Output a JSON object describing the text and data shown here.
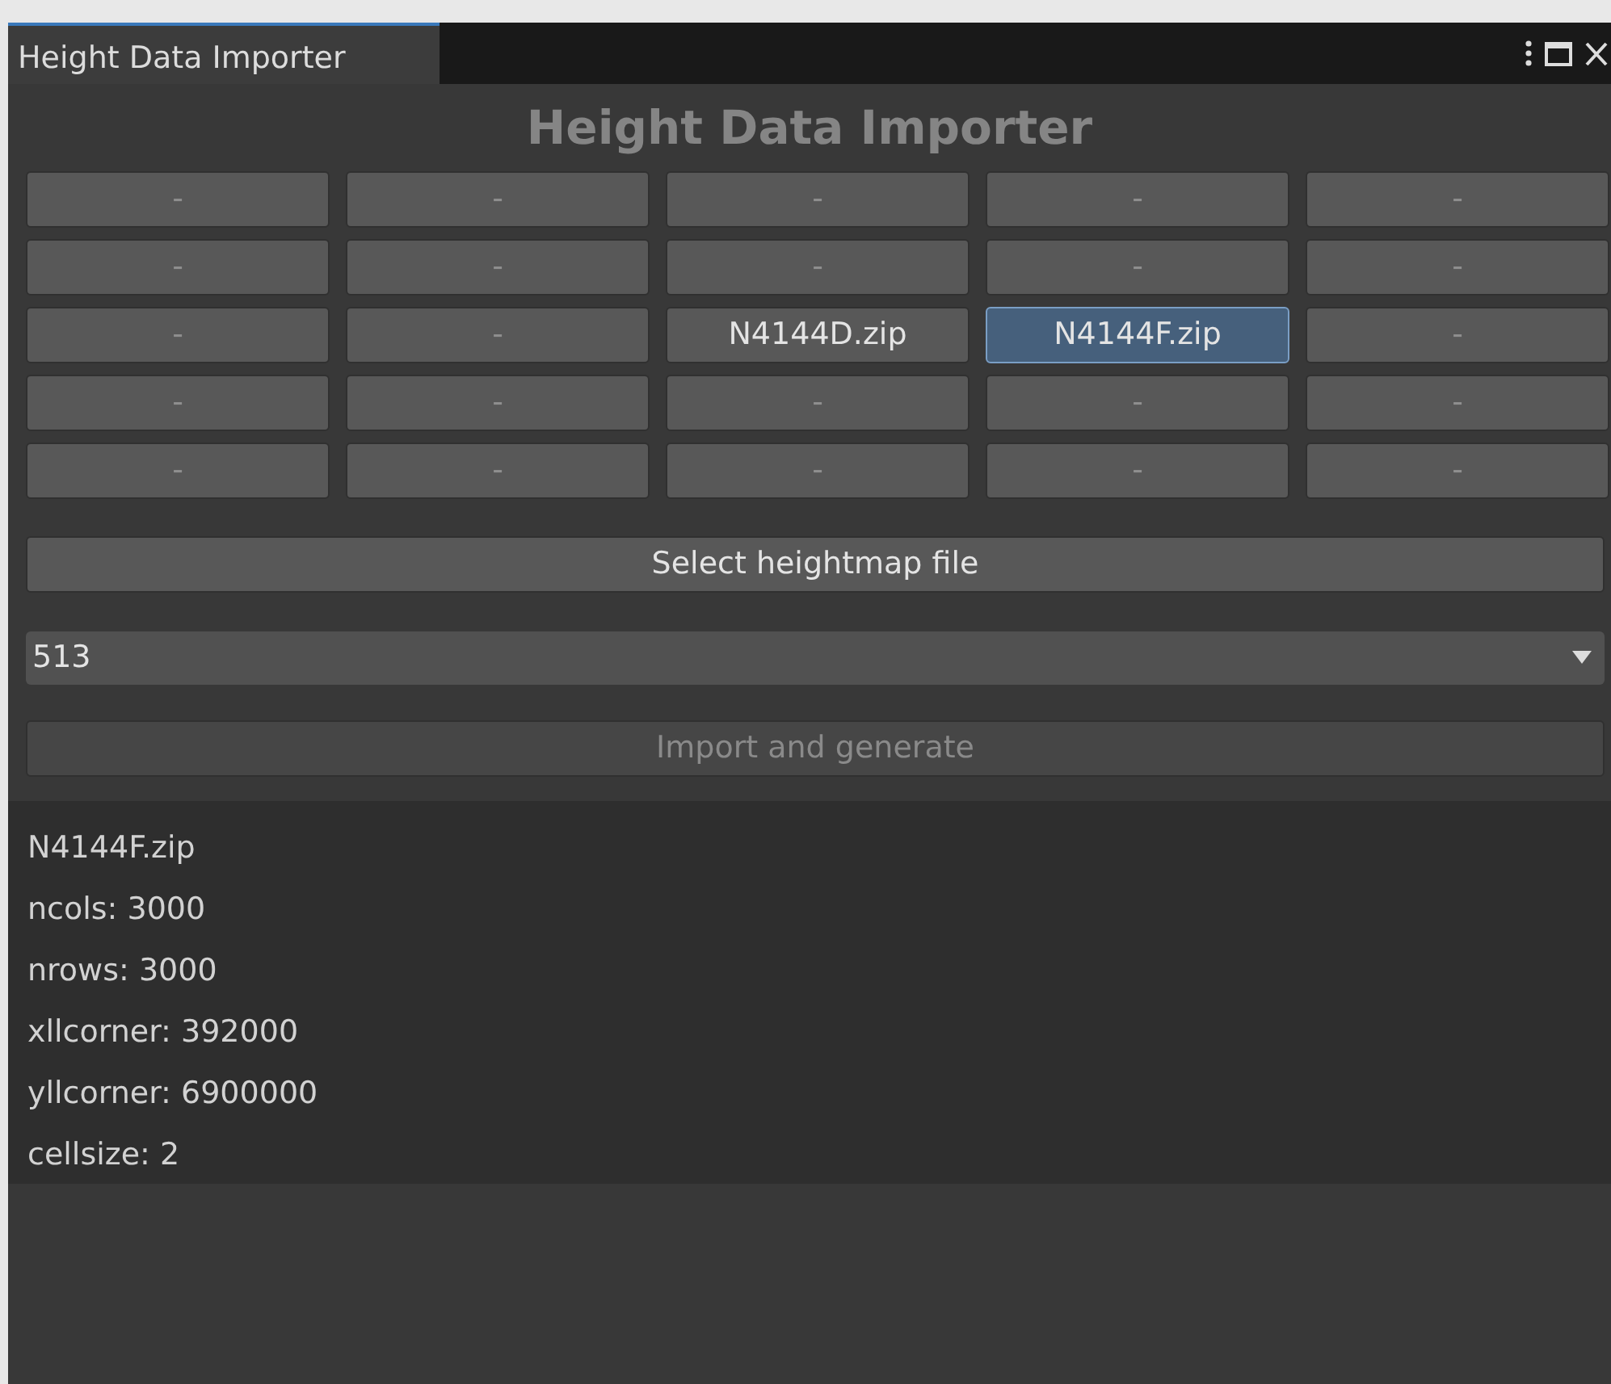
{
  "window": {
    "tab": "Height Data Importer",
    "tab_selected": true
  },
  "title": "Height Data Importer",
  "tiles": [
    [
      {
        "label": "-",
        "selected": false,
        "disabled": true
      },
      {
        "label": "-",
        "selected": false,
        "disabled": true
      },
      {
        "label": "-",
        "selected": false,
        "disabled": true
      },
      {
        "label": "-",
        "selected": false,
        "disabled": true
      },
      {
        "label": "-",
        "selected": false,
        "disabled": true
      }
    ],
    [
      {
        "label": "-",
        "selected": false,
        "disabled": true
      },
      {
        "label": "-",
        "selected": false,
        "disabled": true
      },
      {
        "label": "-",
        "selected": false,
        "disabled": true
      },
      {
        "label": "-",
        "selected": false,
        "disabled": true
      },
      {
        "label": "-",
        "selected": false,
        "disabled": true
      }
    ],
    [
      {
        "label": "-",
        "selected": false,
        "disabled": true
      },
      {
        "label": "-",
        "selected": false,
        "disabled": true
      },
      {
        "label": "N4144D.zip",
        "selected": false,
        "disabled": false
      },
      {
        "label": "N4144F.zip",
        "selected": true,
        "disabled": false
      },
      {
        "label": "-",
        "selected": false,
        "disabled": true
      }
    ],
    [
      {
        "label": "-",
        "selected": false,
        "disabled": true
      },
      {
        "label": "-",
        "selected": false,
        "disabled": true
      },
      {
        "label": "-",
        "selected": false,
        "disabled": true
      },
      {
        "label": "-",
        "selected": false,
        "disabled": true
      },
      {
        "label": "-",
        "selected": false,
        "disabled": true
      }
    ],
    [
      {
        "label": "-",
        "selected": false,
        "disabled": true
      },
      {
        "label": "-",
        "selected": false,
        "disabled": true
      },
      {
        "label": "-",
        "selected": false,
        "disabled": true
      },
      {
        "label": "-",
        "selected": false,
        "disabled": true
      },
      {
        "label": "-",
        "selected": false,
        "disabled": true
      }
    ]
  ],
  "select_button": {
    "label": "Select heightmap file",
    "disabled": false
  },
  "resolution_dropdown": {
    "value": "513"
  },
  "import_button": {
    "label": "Import and generate",
    "disabled": true
  },
  "info_lines": [
    "N4144F.zip",
    "ncols: 3000",
    "nrows: 3000",
    "xllcorner: 392000",
    "yllcorner: 6900000",
    "cellsize: 2"
  ]
}
